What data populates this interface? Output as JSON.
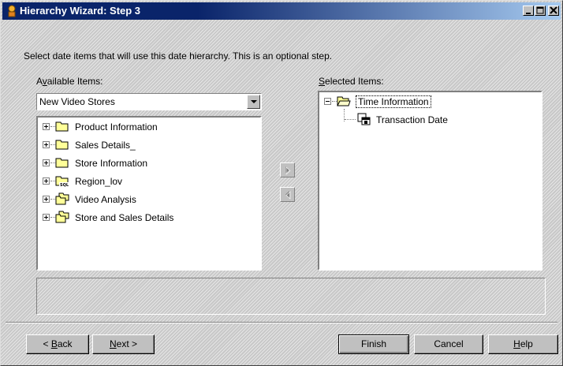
{
  "window": {
    "title": "Hierarchy Wizard: Step 3"
  },
  "instruction": "Select date items that will use this date hierarchy. This is an optional step.",
  "available": {
    "label_pre": "A",
    "label_key": "v",
    "label_post": "ailable Items:",
    "combo_value": "New Video Stores",
    "items": [
      {
        "label": "Product  Information",
        "icon": "folder-icon"
      },
      {
        "label": "Sales Details_",
        "icon": "folder-icon"
      },
      {
        "label": "Store Information",
        "icon": "folder-icon"
      },
      {
        "label": "Region_lov",
        "icon": "sql-folder-icon"
      },
      {
        "label": "Video Analysis",
        "icon": "stacked-folders-icon"
      },
      {
        "label": "Store and Sales Details",
        "icon": "stacked-folders-icon"
      }
    ]
  },
  "selected": {
    "label_key": "S",
    "label_post": "elected Items:",
    "root": {
      "label": "Time Information",
      "icon": "open-folder-icon"
    },
    "child": {
      "label": "Transaction Date",
      "icon": "date-item-icon"
    }
  },
  "buttons": {
    "back_pre": "< ",
    "back_key": "B",
    "back_post": "ack",
    "next_key": "N",
    "next_post": "ext >",
    "finish": "Finish",
    "cancel": "Cancel",
    "help_key": "H",
    "help_post": "elp"
  },
  "colors": {
    "titlebar_start": "#0a246a",
    "titlebar_end": "#a6caf0",
    "face": "#c0c0c0",
    "folder": "#ffff99"
  }
}
